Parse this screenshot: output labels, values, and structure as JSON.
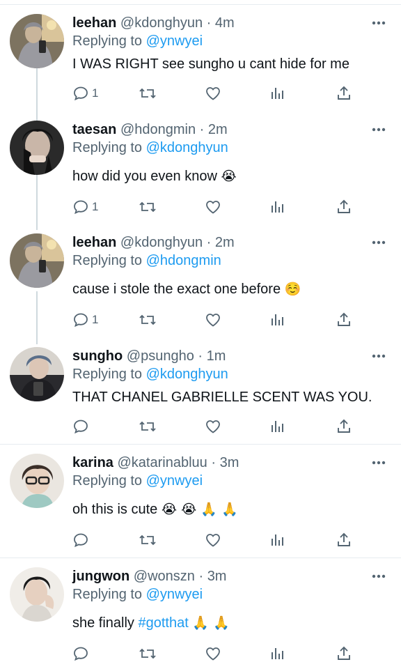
{
  "tweets": [
    {
      "name": "leehan",
      "handle": "@kdonghyun",
      "time": "4m",
      "replying_label": "Replying to",
      "replying_to": "@ynwyei",
      "text": "I WAS RIGHT see sungho u cant hide for me",
      "reply_count": "1",
      "avatar": "leehan-avatar"
    },
    {
      "name": "taesan",
      "handle": "@hdongmin",
      "time": "2m",
      "replying_label": "Replying to",
      "replying_to": "@kdonghyun",
      "text": "how did you even know",
      "emoji": "😭",
      "reply_count": "1",
      "avatar": "taesan-avatar"
    },
    {
      "name": "leehan",
      "handle": "@kdonghyun",
      "time": "2m",
      "replying_label": "Replying to",
      "replying_to": "@hdongmin",
      "text": "cause i stole the exact one before",
      "emoji": "☺️",
      "reply_count": "1",
      "avatar": "leehan-avatar"
    },
    {
      "name": "sungho",
      "handle": "@psungho",
      "time": "1m",
      "replying_label": "Replying to",
      "replying_to": "@kdonghyun",
      "text": "THAT CHANEL GABRIELLE SCENT WAS YOU.",
      "reply_count": "",
      "avatar": "sungho-avatar"
    },
    {
      "name": "karina",
      "handle": "@katarinabluu",
      "time": "3m",
      "replying_label": "Replying to",
      "replying_to": "@ynwyei",
      "text": "oh this is cute",
      "emoji": "😭 😭 🙏 🙏",
      "reply_count": "",
      "avatar": "karina-avatar"
    },
    {
      "name": "jungwon",
      "handle": "@wonszn",
      "time": "3m",
      "replying_label": "Replying to",
      "replying_to": "@ynwyei",
      "text": "she finally",
      "hashtag": "#gotthat",
      "emoji": "🙏 🙏",
      "reply_count": "",
      "avatar": "jungwon-avatar"
    }
  ],
  "separator": "·",
  "icons": [
    "reply-icon",
    "retweet-icon",
    "like-icon",
    "views-icon",
    "share-icon",
    "more-icon"
  ],
  "colors": {
    "link": "#1d9bf0",
    "muted": "#536471",
    "text": "#0f1419",
    "divider": "#e6ecf0"
  }
}
